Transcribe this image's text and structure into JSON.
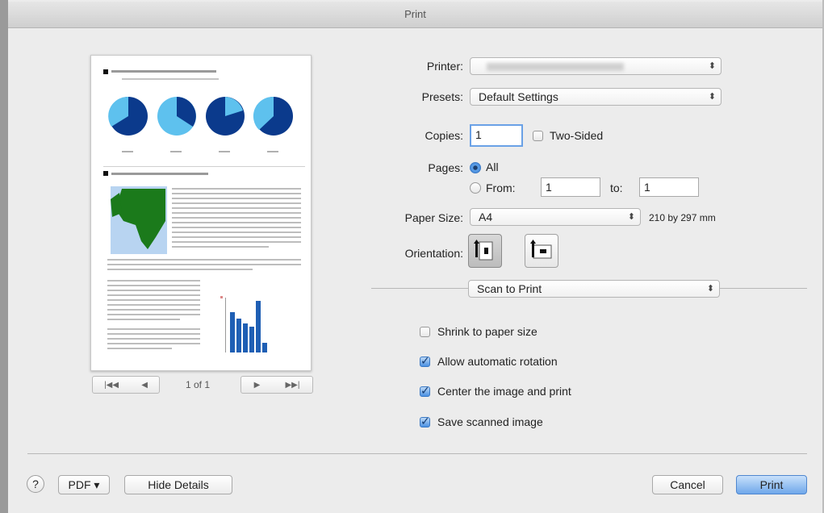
{
  "window": {
    "title": "Print"
  },
  "preview": {
    "page_indicator": "1 of 1",
    "nav_first": "|◀◀",
    "nav_prev": "◀",
    "nav_next": "▶",
    "nav_last": "▶▶|"
  },
  "form": {
    "printer_label": "Printer:",
    "printer_value": "",
    "presets_label": "Presets:",
    "presets_value": "Default Settings",
    "copies_label": "Copies:",
    "copies_value": "1",
    "two_sided_label": "Two-Sided",
    "pages_label": "Pages:",
    "pages_all_label": "All",
    "pages_from_label": "From:",
    "pages_from_value": "1",
    "pages_to_label": "to:",
    "pages_to_value": "1",
    "paper_size_label": "Paper Size:",
    "paper_size_value": "A4",
    "paper_size_dims": "210 by 297 mm",
    "orientation_label": "Orientation:",
    "section_value": "Scan to Print"
  },
  "options": [
    {
      "label": "Shrink to paper size",
      "checked": false
    },
    {
      "label": "Allow automatic rotation",
      "checked": true
    },
    {
      "label": "Center the image and print",
      "checked": true
    },
    {
      "label": "Save scanned image",
      "checked": true
    }
  ],
  "footer": {
    "help_label": "?",
    "pdf_label": "PDF ▾",
    "hide_details_label": "Hide Details",
    "cancel_label": "Cancel",
    "print_label": "Print"
  },
  "colors": {
    "accent": "#4a90e2",
    "pie_dark": "#0b3a8c",
    "pie_light": "#5ec1ee",
    "map_land": "#1b7a1b",
    "map_sea": "#b8d4f1",
    "bar": "#1f5fb4"
  }
}
